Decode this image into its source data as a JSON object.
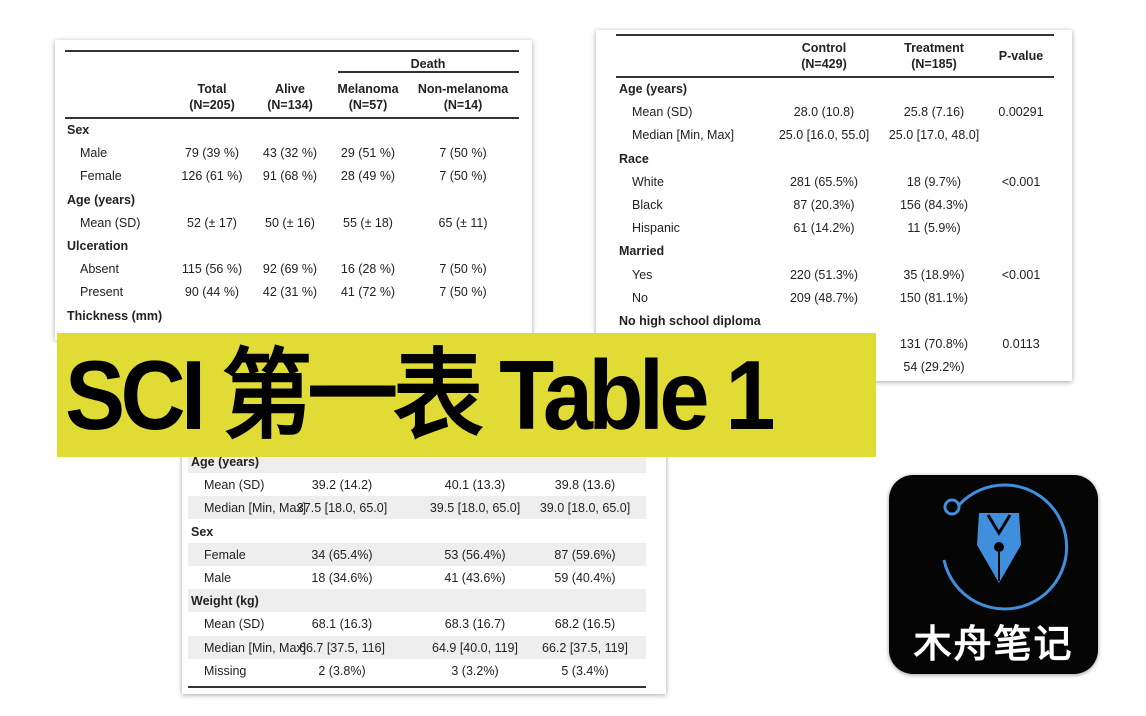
{
  "table1": {
    "group_header": "Death",
    "columns": [
      [
        "Total",
        "(N=205)"
      ],
      [
        "Alive",
        "(N=134)"
      ],
      [
        "Melanoma",
        "(N=57)"
      ],
      [
        "Non-melanoma",
        "(N=14)"
      ]
    ],
    "rows": [
      {
        "label": "Sex",
        "header": true,
        "values": []
      },
      {
        "label": "Male",
        "values": [
          "79 (39 %)",
          "43 (32 %)",
          "29 (51 %)",
          "7 (50 %)"
        ]
      },
      {
        "label": "Female",
        "values": [
          "126 (61 %)",
          "91 (68 %)",
          "28 (49 %)",
          "7 (50 %)"
        ]
      },
      {
        "label": "Age (years)",
        "header": true,
        "values": []
      },
      {
        "label": "Mean (SD)",
        "values": [
          "52 (± 17)",
          "50 (± 16)",
          "55 (± 18)",
          "65 (± 11)"
        ]
      },
      {
        "label": "Ulceration",
        "header": true,
        "values": []
      },
      {
        "label": "Absent",
        "values": [
          "115 (56 %)",
          "92 (69 %)",
          "16 (28 %)",
          "7 (50 %)"
        ]
      },
      {
        "label": "Present",
        "values": [
          "90 (44 %)",
          "42 (31 %)",
          "41 (72 %)",
          "7 (50 %)"
        ]
      },
      {
        "label": "Thickness (mm)",
        "header": true,
        "values": []
      }
    ]
  },
  "table2": {
    "columns": [
      [
        "Control",
        "(N=429)"
      ],
      [
        "Treatment",
        "(N=185)"
      ],
      [
        "P-value"
      ]
    ],
    "rows": [
      {
        "label": "Age (years)",
        "header": true,
        "values": []
      },
      {
        "label": "Mean (SD)",
        "values": [
          "28.0 (10.8)",
          "25.8 (7.16)",
          "0.00291"
        ]
      },
      {
        "label": "Median [Min, Max]",
        "values": [
          "25.0 [16.0, 55.0]",
          "25.0 [17.0, 48.0]",
          ""
        ]
      },
      {
        "label": "Race",
        "header": true,
        "values": []
      },
      {
        "label": "White",
        "values": [
          "281 (65.5%)",
          "18 (9.7%)",
          "<0.001"
        ]
      },
      {
        "label": "Black",
        "values": [
          "87 (20.3%)",
          "156 (84.3%)",
          ""
        ]
      },
      {
        "label": "Hispanic",
        "values": [
          "61 (14.2%)",
          "11 (5.9%)",
          ""
        ]
      },
      {
        "label": "Married",
        "header": true,
        "values": []
      },
      {
        "label": "Yes",
        "values": [
          "220 (51.3%)",
          "35 (18.9%)",
          "<0.001"
        ]
      },
      {
        "label": "No",
        "values": [
          "209 (48.7%)",
          "150 (81.1%)",
          ""
        ]
      },
      {
        "label": "No high school diploma",
        "header": true,
        "values": []
      },
      {
        "label": "",
        "values": [
          "",
          "131 (70.8%)",
          "0.0113"
        ]
      },
      {
        "label": "",
        "values": [
          "",
          "54 (29.2%)",
          ""
        ]
      }
    ]
  },
  "table3": {
    "rows": [
      {
        "label": "Age (years)",
        "header": true,
        "values": []
      },
      {
        "label": "Mean (SD)",
        "values": [
          "39.2 (14.2)",
          "40.1 (13.3)",
          "39.8 (13.6)"
        ]
      },
      {
        "label": "Median [Min, Max]",
        "values": [
          "37.5 [18.0, 65.0]",
          "39.5 [18.0, 65.0]",
          "39.0 [18.0, 65.0]"
        ]
      },
      {
        "label": "Sex",
        "header": true,
        "values": []
      },
      {
        "label": "Female",
        "values": [
          "34 (65.4%)",
          "53 (56.4%)",
          "87 (59.6%)"
        ]
      },
      {
        "label": "Male",
        "values": [
          "18 (34.6%)",
          "41 (43.6%)",
          "59 (40.4%)"
        ]
      },
      {
        "label": "Weight (kg)",
        "header": true,
        "values": []
      },
      {
        "label": "Mean (SD)",
        "values": [
          "68.1 (16.3)",
          "68.3 (16.7)",
          "68.2 (16.5)"
        ]
      },
      {
        "label": "Median [Min, Max]",
        "values": [
          "66.7 [37.5, 116]",
          "64.9 [40.0, 119]",
          "66.2 [37.5, 119]"
        ]
      },
      {
        "label": "Missing",
        "values": [
          "2 (3.8%)",
          "3 (3.2%)",
          "5 (3.4%)"
        ]
      }
    ]
  },
  "banner": {
    "title": "SCI 第一表 Table 1",
    "background": "#e0dc35"
  },
  "logo": {
    "text": "木舟笔记",
    "icon": "fountain-pen-nib-icon",
    "accent": "#4a9ee8"
  }
}
